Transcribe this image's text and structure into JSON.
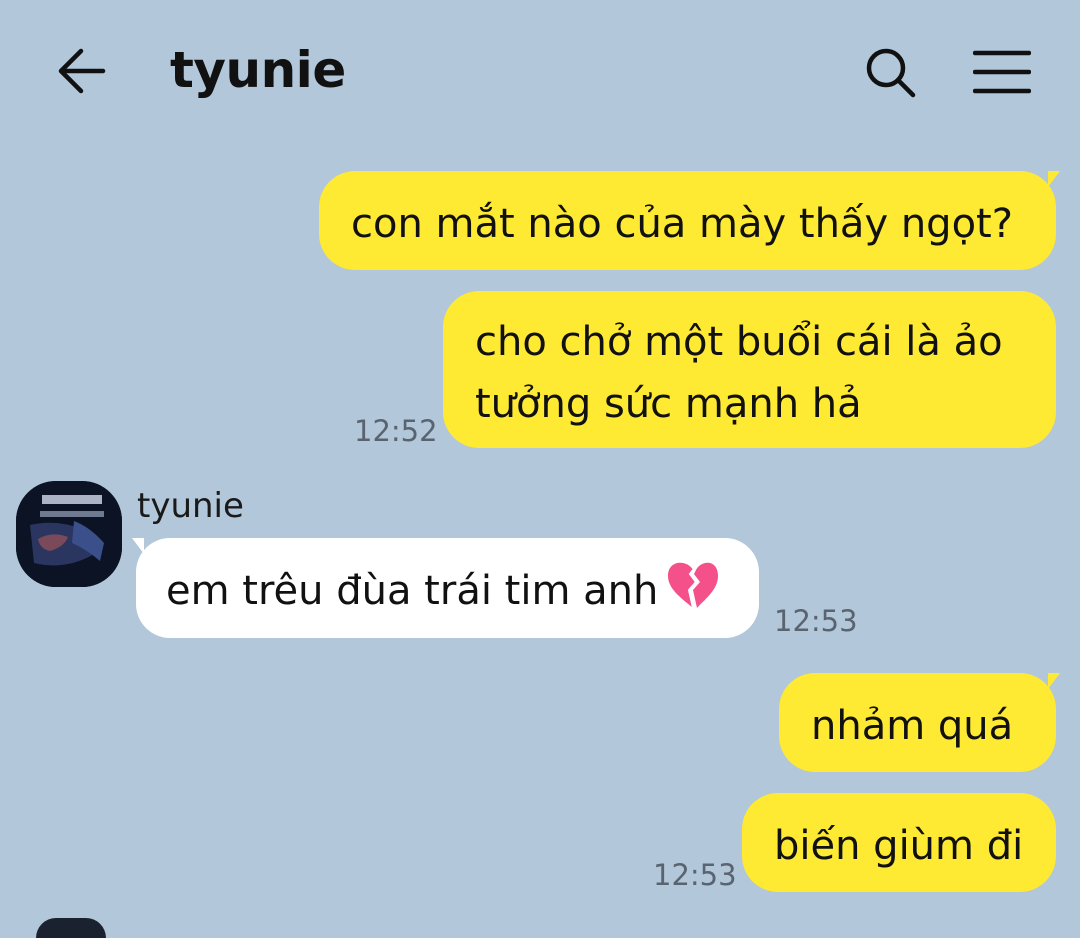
{
  "header": {
    "title": "tyunie",
    "icons": [
      "back-arrow-icon",
      "search-icon",
      "menu-icon"
    ]
  },
  "messages": [
    {
      "from": "me",
      "text": "con mắt nào của mày thấy ngọt?"
    },
    {
      "from": "me",
      "lines": [
        "cho chở một buổi cái là ảo",
        "tưởng sức mạnh hả"
      ],
      "time": "12:52"
    },
    {
      "from": "tyunie",
      "sender": "tyunie",
      "text": "em trêu đùa trái tim anh",
      "emoji": "broken-heart",
      "time": "12:53"
    },
    {
      "from": "me",
      "text": "nhảm quá"
    },
    {
      "from": "me",
      "text": "biến giùm đi",
      "time": "12:53"
    }
  ],
  "colors": {
    "background": "#b2c7da",
    "my_bubble": "#fee933",
    "their_bubble": "#ffffff",
    "time_text": "#5a6470"
  }
}
